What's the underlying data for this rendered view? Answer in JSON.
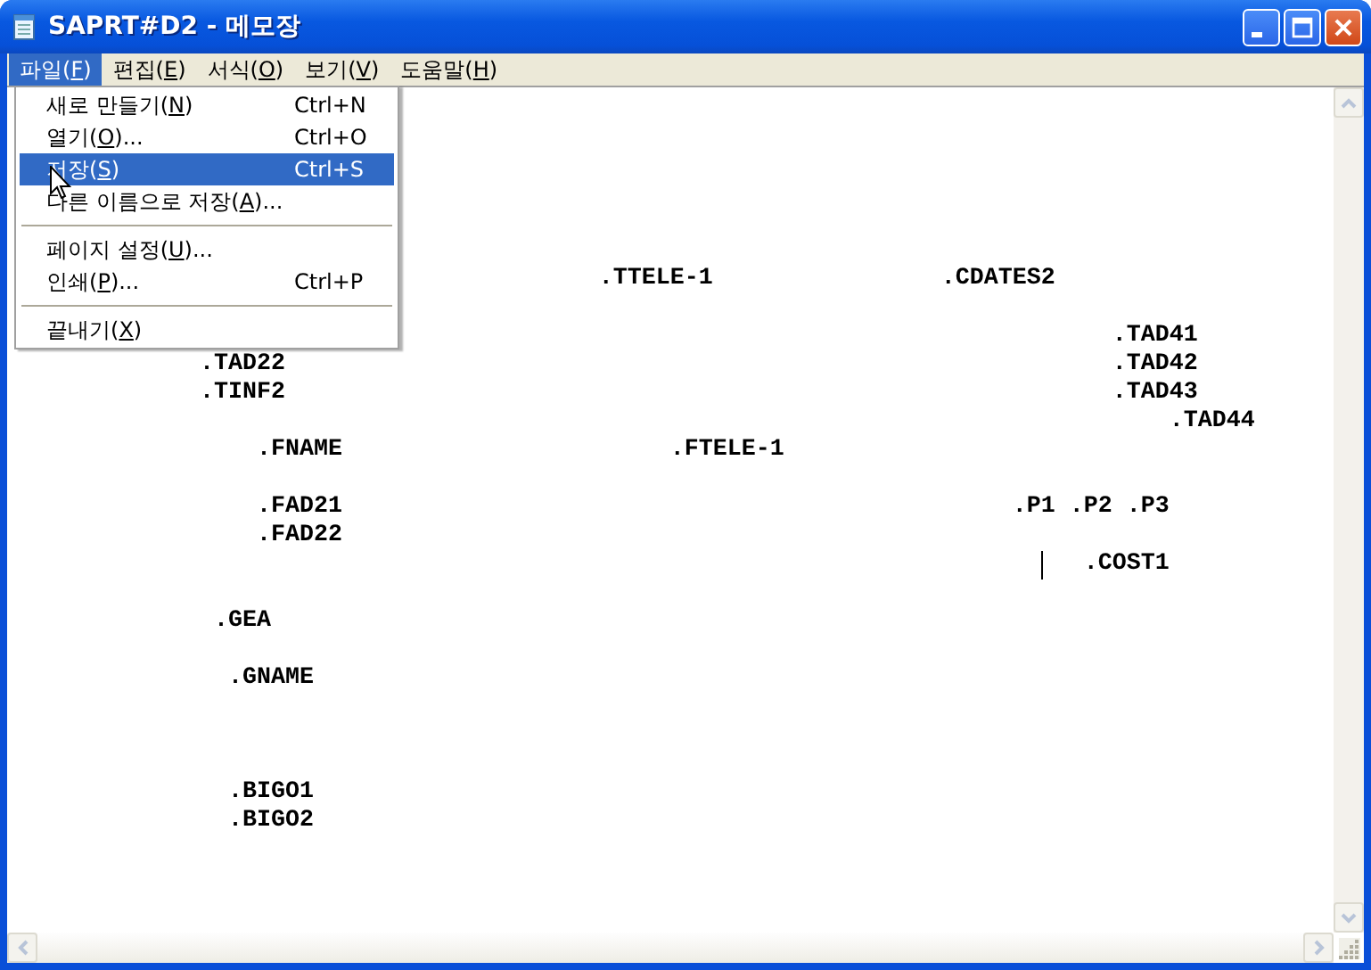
{
  "window": {
    "title": "SAPRT#D2 - 메모장"
  },
  "menu_bar": [
    {
      "label": "파일(",
      "access_key": "F",
      "label_end": ")",
      "selected": true
    },
    {
      "label": "편집(",
      "access_key": "E",
      "label_end": ")",
      "selected": false
    },
    {
      "label": "서식(",
      "access_key": "O",
      "label_end": ")",
      "selected": false
    },
    {
      "label": "보기(",
      "access_key": "V",
      "label_end": ")",
      "selected": false
    },
    {
      "label": "도움말(",
      "access_key": "H",
      "label_end": ")",
      "selected": false
    }
  ],
  "file_menu": [
    {
      "kind": "item",
      "label": "새로 만들기(",
      "access_key": "N",
      "label_end": ")",
      "shortcut": "Ctrl+N",
      "selected": false
    },
    {
      "kind": "item",
      "label": "열기(",
      "access_key": "O",
      "label_end": ")...",
      "shortcut": "Ctrl+O",
      "selected": false
    },
    {
      "kind": "item",
      "label": "저장(",
      "access_key": "S",
      "label_end": ")",
      "shortcut": "Ctrl+S",
      "selected": true
    },
    {
      "kind": "item",
      "label": "다른 이름으로 저장(",
      "access_key": "A",
      "label_end": ")...",
      "selected": false
    },
    {
      "kind": "separator"
    },
    {
      "kind": "item",
      "label": "페이지 설정(",
      "access_key": "U",
      "label_end": ")...",
      "selected": false
    },
    {
      "kind": "item",
      "label": "인쇄(",
      "access_key": "P",
      "label_end": ")...",
      "shortcut": "Ctrl+P",
      "selected": false
    },
    {
      "kind": "separator"
    },
    {
      "kind": "item",
      "label": "끝내기(",
      "access_key": "X",
      "label_end": ")",
      "selected": false
    }
  ],
  "editor": {
    "text_before_caret": "\n\n\n\n\n\n                                        .TTELE-1                .CDATES2\n\n                                                                            .TAD41\n            .TAD22                                                          .TAD42\n            .TINF2                                                          .TAD43\n                                                                                .TAD44\n                .FNAME                       .FTELE-1\n\n                .FAD21                                               .P1 .P2 .P3\n                .FAD22\n                                                                       ",
    "text_after_caret": "   .COST1\n\n             .GEA\n\n              .GNAME\n\n\n\n              .BIGO1\n              .BIGO2"
  }
}
